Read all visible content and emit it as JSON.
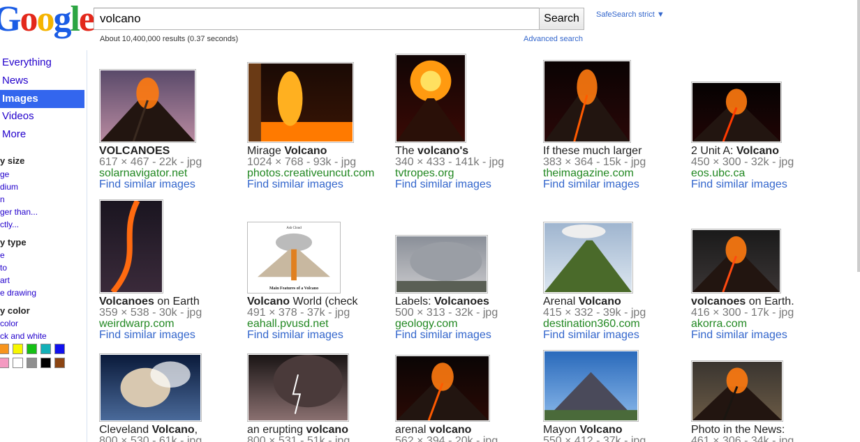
{
  "logo": {
    "letters": [
      "G",
      "o",
      "o",
      "g",
      "l",
      "e"
    ],
    "colors": [
      "#1a5ce5",
      "#e3281b",
      "#f5b400",
      "#1a5ce5",
      "#2ca543",
      "#e3281b"
    ]
  },
  "search": {
    "query": "volcano",
    "button_label": "Search"
  },
  "safesearch_label": "SafeSearch strict ▼",
  "stats": "About 10,400,000 results (0.37 seconds)",
  "advanced_label": "Advanced search",
  "sidebar": {
    "nav": [
      "Everything",
      "News",
      "Images",
      "Videos",
      "More"
    ],
    "active_nav": "Images",
    "size_head": "y size",
    "size_links": [
      "ge",
      "dium",
      "n",
      "ger than...",
      "ctly..."
    ],
    "type_head": "y type",
    "type_links": [
      "e",
      "to",
      " art",
      "e drawing"
    ],
    "color_head": "y color",
    "color_links": [
      " color",
      "ck and white"
    ],
    "swatches_row1": [
      "#f7941d",
      "#f7f700",
      "#15c015",
      "#13b0b8",
      "#1111ee"
    ],
    "swatches_row2": [
      "#f49ac1",
      "#ffffff",
      "#8f8f8f",
      "#000000",
      "#8b4513"
    ]
  },
  "results": [
    {
      "title": [
        [
          "VOLCANOES",
          true
        ]
      ],
      "meta": "617 × 467 - 22k - jpg",
      "site": "solarnavigator.net",
      "similar": "Find similar images"
    },
    {
      "title": [
        [
          "Mirage ",
          false
        ],
        [
          "Volcano",
          true
        ]
      ],
      "meta": "1024 × 768 - 93k - jpg",
      "site": "photos.creativeuncut.com",
      "similar": "Find similar images"
    },
    {
      "title": [
        [
          "The ",
          false
        ],
        [
          "volcano's",
          true
        ]
      ],
      "meta": "340 × 433 - 141k - jpg",
      "site": "tvtropes.org",
      "similar": "Find similar images"
    },
    {
      "title": [
        [
          "If these much larger",
          false
        ]
      ],
      "meta": "383 × 364 - 15k - jpg",
      "site": "theimagazine.com",
      "similar": "Find similar images"
    },
    {
      "title": [
        [
          "2 Unit A: ",
          false
        ],
        [
          "Volcano",
          true
        ]
      ],
      "meta": "450 × 300 - 32k - jpg",
      "site": "eos.ubc.ca",
      "similar": "Find similar images"
    },
    {
      "title": [
        [
          "Volcanoes",
          true
        ],
        [
          " on Earth",
          false
        ]
      ],
      "meta": "359 × 538 - 30k - jpg",
      "site": "weirdwarp.com",
      "similar": "Find similar images"
    },
    {
      "title": [
        [
          "Volcano",
          true
        ],
        [
          " World (check",
          false
        ]
      ],
      "meta": "491 × 378 - 37k - jpg",
      "site": "eahall.pvusd.net",
      "similar": "Find similar images"
    },
    {
      "title": [
        [
          "Labels: ",
          false
        ],
        [
          "Volcanoes",
          true
        ]
      ],
      "meta": "500 × 313 - 32k - jpg",
      "site": "geology.com",
      "similar": "Find similar images"
    },
    {
      "title": [
        [
          "Arenal ",
          false
        ],
        [
          "Volcano",
          true
        ]
      ],
      "meta": "415 × 332 - 39k - jpg",
      "site": "destination360.com",
      "similar": "Find similar images"
    },
    {
      "title": [
        [
          "volcanoes",
          true
        ],
        [
          " on Earth.",
          false
        ]
      ],
      "meta": "416 × 300 - 17k - jpg",
      "site": "akorra.com",
      "similar": "Find similar images"
    },
    {
      "title": [
        [
          "Cleveland ",
          false
        ],
        [
          "Volcano",
          true
        ],
        [
          ",",
          false
        ]
      ],
      "meta": "800 × 530 - 61k - jpg",
      "site": "",
      "similar": ""
    },
    {
      "title": [
        [
          "an erupting ",
          false
        ],
        [
          "volcano",
          true
        ]
      ],
      "meta": "800 × 531 - 51k - jpg",
      "site": "",
      "similar": ""
    },
    {
      "title": [
        [
          "arenal ",
          false
        ],
        [
          "volcano",
          true
        ]
      ],
      "meta": "562 × 394 - 20k - jpg",
      "site": "",
      "similar": ""
    },
    {
      "title": [
        [
          "Mayon ",
          false
        ],
        [
          "Volcano",
          true
        ]
      ],
      "meta": "550 × 412 - 37k - jpg",
      "site": "",
      "similar": ""
    },
    {
      "title": [
        [
          "Photo in the News:",
          false
        ]
      ],
      "meta": "461 × 306 - 34k - jpg",
      "site": "",
      "similar": ""
    }
  ],
  "diagram_thumb": {
    "title": "Main Features of a Volcano",
    "top_label": "Ash Cloud"
  }
}
